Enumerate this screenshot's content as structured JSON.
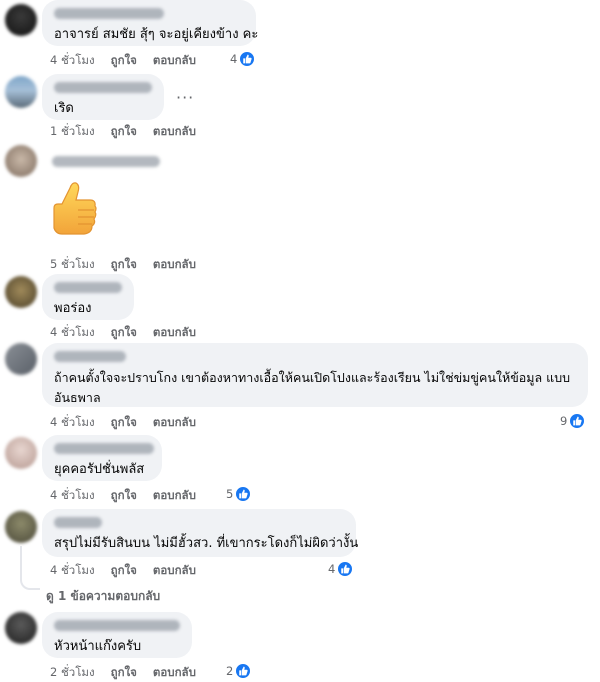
{
  "comments": [
    {
      "text": "อาจารย์ สมชัย สุ้ๆ จะอยู่เคียงข้าง คะ",
      "time": "4 ชั่วโมง",
      "like": "ถูกใจ",
      "reply": "ตอบกลับ",
      "reactions": "4"
    },
    {
      "text": "เริด",
      "time": "1 ชั่วโมง",
      "like": "ถูกใจ",
      "reply": "ตอบกลับ",
      "more": "···"
    },
    {
      "text": "",
      "time": "5 ชั่วโมง",
      "like": "ถูกใจ",
      "reply": "ตอบกลับ",
      "sticker": "thumbs-up"
    },
    {
      "text": "พอร่อง",
      "time": "4 ชั่วโมง",
      "like": "ถูกใจ",
      "reply": "ตอบกลับ"
    },
    {
      "text_line1": "ถ้าคนตั้งใจจะปราบโกง เขาต้องหาทางเอื้อให้คนเปิดโปงและร้องเรียน ไม่ใช่ข่มขู่คนให้ข้อมูล แบบ",
      "text_line2": "อันธพาล",
      "time": "4 ชั่วโมง",
      "like": "ถูกใจ",
      "reply": "ตอบกลับ",
      "reactions": "9"
    },
    {
      "text": "ยุคคอรัปชั่นพลัส",
      "time": "4 ชั่วโมง",
      "like": "ถูกใจ",
      "reply": "ตอบกลับ",
      "reactions": "5"
    },
    {
      "text": "สรุปไม่มีรับสินบน ไม่มีฮั้วสว. ที่เขากระโดงก็ไม่ผิดว่างั้น",
      "time": "4 ชั่วโมง",
      "like": "ถูกใจ",
      "reply": "ตอบกลับ",
      "reactions": "4",
      "view_replies": "ดู 1 ข้อความตอบกลับ"
    },
    {
      "text": "หัวหน้าแก๊งครับ",
      "time": "2 ชั่วโมง",
      "like": "ถูกใจ",
      "reply": "ตอบกลับ",
      "reactions": "2"
    }
  ],
  "colors": {
    "bubble": "#f0f2f5",
    "like_blue": "#1877f2",
    "meta_gray": "#65676b"
  }
}
